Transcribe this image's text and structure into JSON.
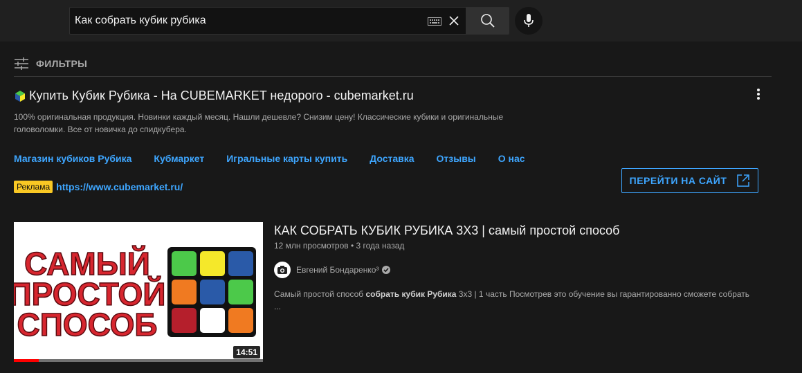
{
  "search": {
    "query": "Как собрать кубик рубика"
  },
  "filters": {
    "label": "ФИЛЬТРЫ"
  },
  "ad": {
    "title": "Купить Кубик Рубика - На CUBEMARKET недорого - cubemarket.ru",
    "description": "100% оригинальная продукция. Новинки каждый месяц. Нашли дешевле? Снизим цену! Классические кубики и оригинальные головоломки. Все от новичка до спидкубера.",
    "sitelinks": [
      {
        "label": "Магазин кубиков Рубика"
      },
      {
        "label": "Кубмаркет"
      },
      {
        "label": "Игральные карты купить"
      },
      {
        "label": "Доставка"
      },
      {
        "label": "Отзывы"
      },
      {
        "label": "О нас"
      }
    ],
    "badge": "Реклама",
    "url": "https://www.cubemarket.ru/",
    "cta": "ПЕРЕЙТИ НА САЙТ"
  },
  "video": {
    "title": "КАК СОБРАТЬ КУБИК РУБИКА 3Х3 | самый простой способ",
    "views": "12 млн просмотров",
    "separator": "•",
    "age": "3 года назад",
    "channel": "Евгений Бондаренко³",
    "description_prefix": "Самый простой способ ",
    "description_bold": "собрать кубик Рубика",
    "description_suffix": " 3х3 | 1 часть Посмотрев это обучение вы гарантированно сможете собрать ...",
    "duration": "14:51",
    "watched_fraction": 0.1,
    "thumbnail": {
      "line1": "САМЫЙ",
      "line2": "ПРОСТОЙ",
      "line3": "СПОСОБ",
      "text_color": "#d7262f",
      "cube_colors": [
        "#4cc94a",
        "#f5e82a",
        "#2a5aa8",
        "#f07a21",
        "#2a5aa8",
        "#4cc94a",
        "#b51f2c",
        "#ffffff",
        "#f07a21"
      ]
    }
  },
  "colors": {
    "background": "#181818",
    "topbar": "#202020",
    "link": "#3ea6ff",
    "badge": "#f9c824",
    "progress": "#ff0000"
  }
}
